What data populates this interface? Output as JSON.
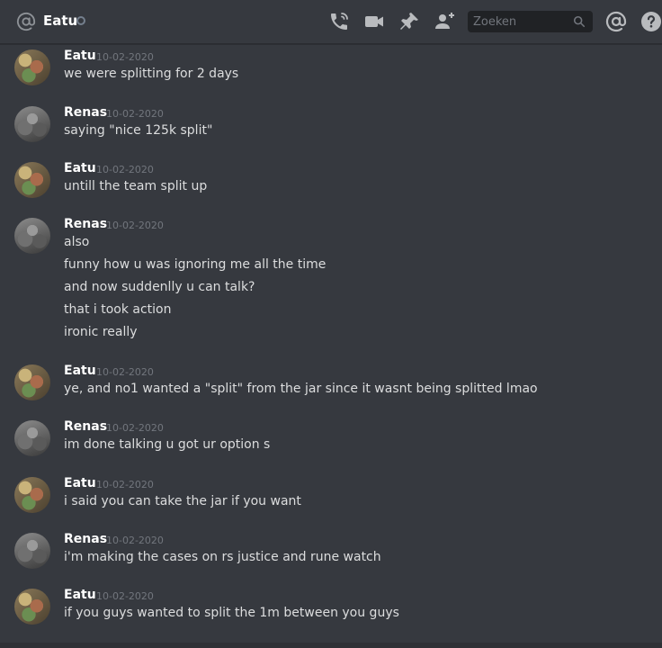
{
  "header": {
    "channel_name": "Eatu",
    "search_placeholder": "Zoeken"
  },
  "icons": {
    "at": "at-icon",
    "status": "offline-status-icon",
    "call": "phone-call-icon",
    "video": "video-call-icon",
    "pin": "pin-icon",
    "add_user": "add-user-icon",
    "search": "search-icon",
    "mentions": "mentions-icon",
    "help": "help-icon"
  },
  "colors": {
    "background": "#36393f",
    "username": "#ffffff",
    "timestamp": "#72767d",
    "text": "#dcddde",
    "icon": "#b9bbbe"
  },
  "messages": [
    {
      "author": "Eatu",
      "timestamp": "10-02-2020",
      "lines": [
        "we were splitting for 2 days"
      ]
    },
    {
      "author": "Renas",
      "timestamp": "10-02-2020",
      "lines": [
        "saying \"nice 125k split\""
      ]
    },
    {
      "author": "Eatu",
      "timestamp": "10-02-2020",
      "lines": [
        "untill the team split up"
      ]
    },
    {
      "author": "Renas",
      "timestamp": "10-02-2020",
      "lines": [
        "also",
        "funny how u was ignoring me all the time",
        "and now suddenlly u can talk?",
        "that i took action",
        "ironic really"
      ]
    },
    {
      "author": "Eatu",
      "timestamp": "10-02-2020",
      "lines": [
        "ye, and no1 wanted a \"split\" from the jar since it wasnt being splitted lmao"
      ]
    },
    {
      "author": "Renas",
      "timestamp": "10-02-2020",
      "lines": [
        "im done talking u got ur option s"
      ]
    },
    {
      "author": "Eatu",
      "timestamp": "10-02-2020",
      "lines": [
        "i said you can take the jar if you want"
      ]
    },
    {
      "author": "Renas",
      "timestamp": "10-02-2020",
      "lines": [
        "i'm making the cases on rs justice and rune watch"
      ]
    },
    {
      "author": "Eatu",
      "timestamp": "10-02-2020",
      "lines": [
        "if you guys wanted to split the 1m between you guys"
      ]
    }
  ]
}
